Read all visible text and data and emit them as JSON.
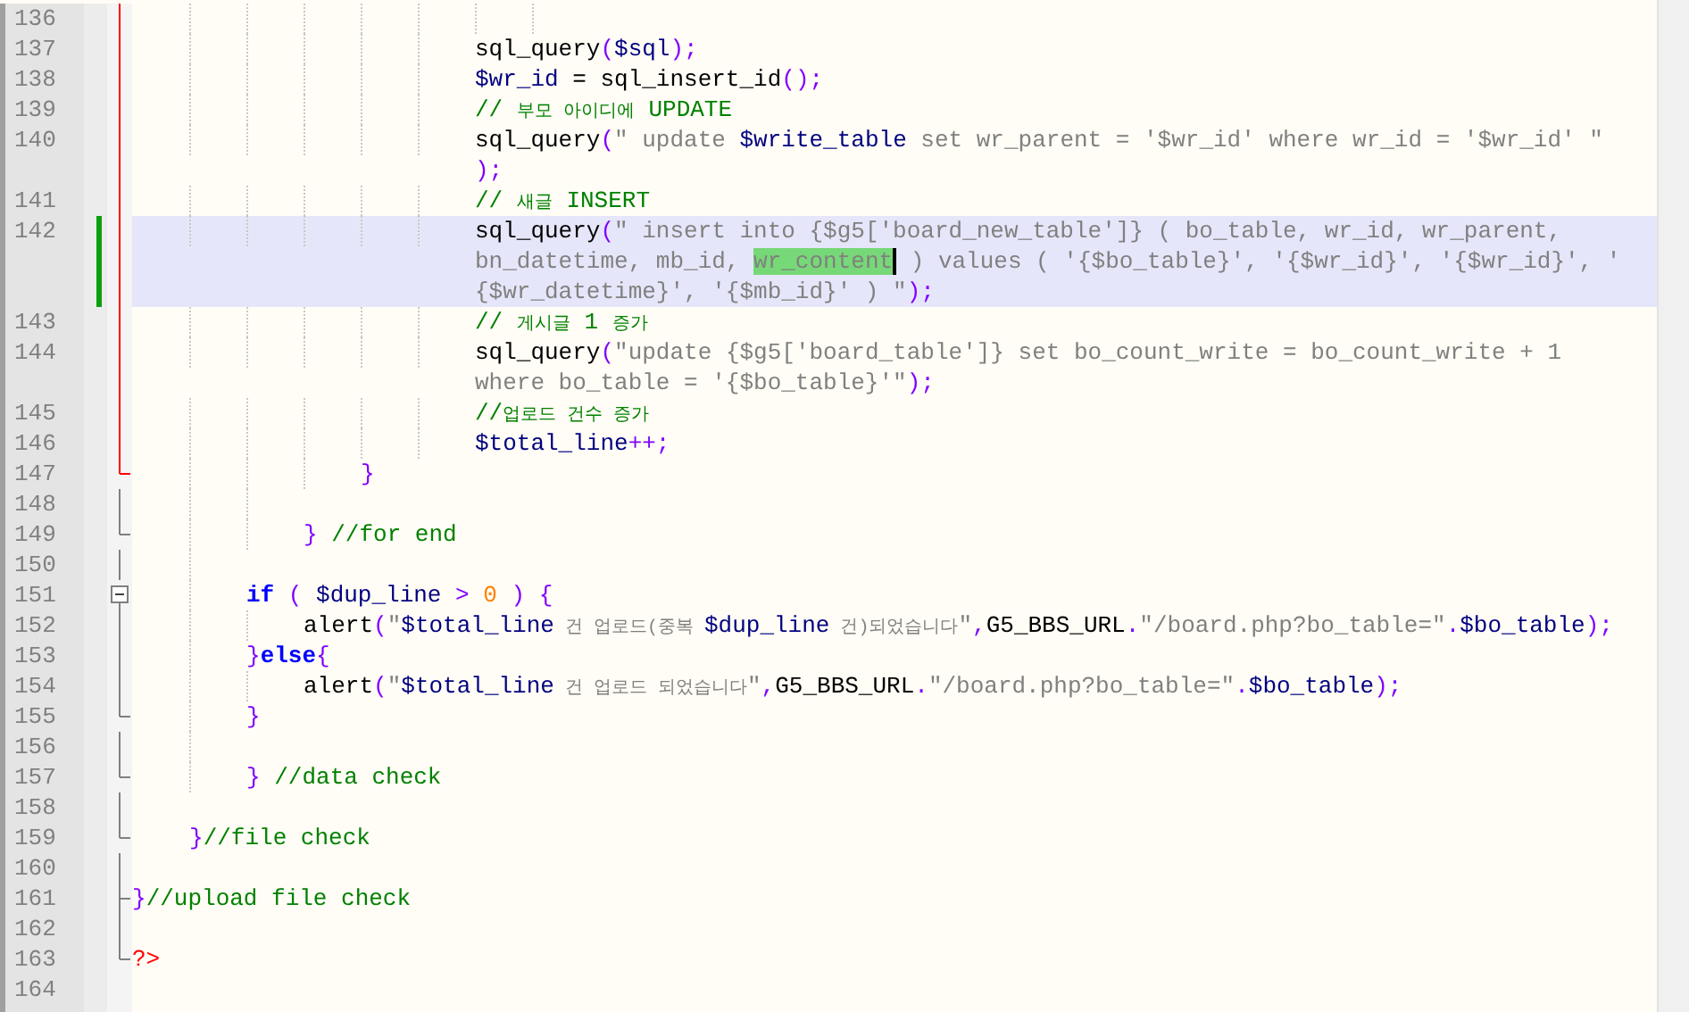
{
  "editor": {
    "lines": [
      {
        "children": [
          {
            "children": [
              {
                "children": [
                  {
                    "children": [
                      {
                        "children": [
                          {
                            "children": [
                              {
                                "children": [
                                  {
                                    "children": [
                                      {
                                        "number": "136",
                                        "kind": "redline",
                                        "changed": false,
                                        "current": false
                                      }
                                    ]
                                  }
                                ]
                              },
                              {
                                "number": "137",
                                "kind": "redline",
                                "changed": false,
                                "current": false,
                                "wraps": [
                                  {
                                    "tokens": [
                                      {
                                        "kind": "fn",
                                        "text": "sql_query"
                                      },
                                      {
                                        "kind": "punc",
                                        "text": "("
                                      },
                                      {
                                        "kind": "var",
                                        "text": "$sql"
                                      },
                                      {
                                        "kind": "punc",
                                        "text": ");"
                                      }
                                    ]
                                  }
                                ]
                              },
                              {
                                "number": "138",
                                "kind": "redline",
                                "changed": false,
                                "current": false,
                                "wraps": [
                                  {
                                    "tokens": [
                                      {
                                        "kind": "var",
                                        "text": "$wr_id"
                                      },
                                      {
                                        "kind": "fn",
                                        "text": " = sql_insert_id"
                                      },
                                      {
                                        "kind": "punc",
                                        "text": "();"
                                      }
                                    ]
                                  }
                                ]
                              },
                              {
                                "number": "139",
                                "kind": "redline",
                                "changed": false,
                                "current": false,
                                "wraps": [
                                  {
                                    "tokens": [
                                      {
                                        "kind": "cmt",
                                        "text": "// "
                                      },
                                      {
                                        "kind": "cmt_kr",
                                        "text": "부모 아이디에"
                                      },
                                      {
                                        "kind": "cmt",
                                        "text": " UPDATE"
                                      }
                                    ]
                                  }
                                ]
                              },
                              {
                                "number": "140",
                                "kind": "redline",
                                "changed": false,
                                "current": false,
                                "wraps": [
                                  {
                                    "tokens": [
                                      {
                                        "kind": "fn",
                                        "text": "sql_query"
                                      },
                                      {
                                        "kind": "punc",
                                        "text": "("
                                      },
                                      {
                                        "kind": "str",
                                        "text": "\" update "
                                      },
                                      {
                                        "kind": "var",
                                        "text": "$write_table"
                                      },
                                      {
                                        "kind": "str",
                                        "text": " set wr_parent = '$wr_id' where wr_id = '$wr_id' \""
                                      }
                                    ]
                                  },
                                  {
                                    "tokens": [
                                      {
                                        "kind": "punc",
                                        "text": ");"
                                      }
                                    ]
                                  }
                                ]
                              },
                              {
                                "number": "141",
                                "kind": "redline",
                                "changed": false,
                                "current": false,
                                "wraps": [
                                  {
                                    "tokens": [
                                      {
                                        "kind": "cmt",
                                        "text": "// "
                                      },
                                      {
                                        "kind": "cmt_kr",
                                        "text": "새글"
                                      },
                                      {
                                        "kind": "cmt",
                                        "text": " INSERT"
                                      }
                                    ]
                                  }
                                ]
                              },
                              {
                                "number": "142",
                                "kind": "redline",
                                "changed": true,
                                "current": true,
                                "wraps": [
                                  {
                                    "tokens": [
                                      {
                                        "kind": "fn",
                                        "text": "sql_query"
                                      },
                                      {
                                        "kind": "punc",
                                        "text": "("
                                      },
                                      {
                                        "kind": "str",
                                        "text": "\" insert into {$g5['board_new_table']} ( bo_table, wr_id, wr_parent,"
                                      }
                                    ]
                                  },
                                  {
                                    "tokens": [
                                      {
                                        "kind": "str",
                                        "text": "bn_datetime, mb_id, "
                                      },
                                      {
                                        "kind": "match",
                                        "text": "wr_content"
                                      },
                                      {
                                        "kind": "str",
                                        "text": " ) values ( '{$bo_table}', '{$wr_id}', '{$wr_id}', '"
                                      }
                                    ]
                                  },
                                  {
                                    "tokens": [
                                      {
                                        "kind": "str",
                                        "text": "{$wr_datetime}', '{$mb_id}' ) \""
                                      },
                                      {
                                        "kind": "punc",
                                        "text": ");"
                                      }
                                    ]
                                  }
                                ]
                              },
                              {
                                "number": "143",
                                "kind": "redline",
                                "changed": false,
                                "current": false,
                                "wraps": [
                                  {
                                    "tokens": [
                                      {
                                        "kind": "cmt",
                                        "text": "// "
                                      },
                                      {
                                        "kind": "cmt_kr",
                                        "text": "게시글"
                                      },
                                      {
                                        "kind": "cmt",
                                        "text": " 1 "
                                      },
                                      {
                                        "kind": "cmt_kr",
                                        "text": "증가"
                                      }
                                    ]
                                  }
                                ]
                              },
                              {
                                "number": "144",
                                "kind": "redline",
                                "changed": false,
                                "current": false,
                                "wraps": [
                                  {
                                    "tokens": [
                                      {
                                        "kind": "fn",
                                        "text": "sql_query"
                                      },
                                      {
                                        "kind": "punc",
                                        "text": "("
                                      },
                                      {
                                        "kind": "str",
                                        "text": "\"update {$g5['board_table']} set bo_count_write = bo_count_write + 1"
                                      }
                                    ]
                                  },
                                  {
                                    "tokens": [
                                      {
                                        "kind": "str",
                                        "text": "where bo_table = '{$bo_table}'\""
                                      },
                                      {
                                        "kind": "punc",
                                        "text": ");"
                                      }
                                    ]
                                  }
                                ]
                              },
                              {
                                "number": "145",
                                "kind": "redline",
                                "changed": false,
                                "current": false,
                                "wraps": [
                                  {
                                    "tokens": [
                                      {
                                        "kind": "cmt",
                                        "text": "//"
                                      },
                                      {
                                        "kind": "cmt_kr",
                                        "text": "업로드 건수 증가"
                                      }
                                    ]
                                  }
                                ]
                              },
                              {
                                "number": "146",
                                "kind": "redline",
                                "changed": false,
                                "current": false,
                                "wraps": [
                                  {
                                    "tokens": [
                                      {
                                        "kind": "var",
                                        "text": "$total_line"
                                      },
                                      {
                                        "kind": "punc",
                                        "text": "++;"
                                      }
                                    ]
                                  }
                                ]
                              }
                            ]
                          }
                        ]
                      },
                      {
                        "number": "147",
                        "kind": "redend",
                        "changed": false,
                        "current": false,
                        "wraps": [
                          {
                            "tokens": [
                              {
                                "kind": "punc",
                                "text": "}"
                              }
                            ]
                          }
                        ]
                      }
                    ]
                  },
                  {
                    "number": "148",
                    "kind": "line",
                    "changed": false,
                    "current": false
                  },
                  {
                    "number": "149",
                    "kind": "end",
                    "changed": false,
                    "current": false,
                    "wraps": [
                      {
                        "tokens": [
                          {
                            "kind": "punc",
                            "text": "}"
                          },
                          {
                            "kind": "cmt",
                            "text": " //for end"
                          }
                        ]
                      }
                    ]
                  }
                ]
              },
              {
                "number": "150",
                "kind": "line",
                "changed": false,
                "current": false
              },
              {
                "number": "151",
                "kind": "box",
                "changed": false,
                "current": false,
                "wraps": [
                  {
                    "tokens": [
                      {
                        "kind": "kw",
                        "text": "if"
                      },
                      {
                        "kind": "punc",
                        "text": " ( "
                      },
                      {
                        "kind": "var",
                        "text": "$dup_line"
                      },
                      {
                        "kind": "punc",
                        "text": " > "
                      },
                      {
                        "kind": "num",
                        "text": "0"
                      },
                      {
                        "kind": "punc",
                        "text": " ) {"
                      }
                    ]
                  }
                ]
              },
              {
                "children": [
                  {
                    "number": "152",
                    "kind": "line",
                    "changed": false,
                    "current": false,
                    "wraps": [
                      {
                        "tokens": [
                          {
                            "kind": "fn",
                            "text": "alert"
                          },
                          {
                            "kind": "punc",
                            "text": "("
                          },
                          {
                            "kind": "str",
                            "text": "\""
                          },
                          {
                            "kind": "var",
                            "text": "$total_line"
                          },
                          {
                            "kind": "str_kr",
                            "text": " 건 업로드(중복 "
                          },
                          {
                            "kind": "var",
                            "text": "$dup_line"
                          },
                          {
                            "kind": "str_kr",
                            "text": " 건)되었습니다"
                          },
                          {
                            "kind": "str",
                            "text": "\""
                          },
                          {
                            "kind": "punc",
                            "text": ","
                          },
                          {
                            "kind": "fn",
                            "text": "G5_BBS_URL"
                          },
                          {
                            "kind": "punc",
                            "text": "."
                          },
                          {
                            "kind": "str",
                            "text": "\"/board.php?bo_table=\""
                          },
                          {
                            "kind": "punc",
                            "text": "."
                          },
                          {
                            "kind": "var",
                            "text": "$bo_table"
                          },
                          {
                            "kind": "punc",
                            "text": ");"
                          }
                        ]
                      }
                    ]
                  }
                ]
              },
              {
                "number": "153",
                "kind": "line",
                "changed": false,
                "current": false,
                "wraps": [
                  {
                    "tokens": [
                      {
                        "kind": "punc",
                        "text": "}"
                      },
                      {
                        "kind": "kw",
                        "text": "else"
                      },
                      {
                        "kind": "punc",
                        "text": "{"
                      }
                    ]
                  }
                ]
              },
              {
                "children": [
                  {
                    "number": "154",
                    "kind": "line",
                    "changed": false,
                    "current": false,
                    "wraps": [
                      {
                        "tokens": [
                          {
                            "kind": "fn",
                            "text": "alert"
                          },
                          {
                            "kind": "punc",
                            "text": "("
                          },
                          {
                            "kind": "str",
                            "text": "\""
                          },
                          {
                            "kind": "var",
                            "text": "$total_line"
                          },
                          {
                            "kind": "str_kr",
                            "text": " 건 업로드 되었습니다"
                          },
                          {
                            "kind": "str",
                            "text": "\""
                          },
                          {
                            "kind": "punc",
                            "text": ","
                          },
                          {
                            "kind": "fn",
                            "text": "G5_BBS_URL"
                          },
                          {
                            "kind": "punc",
                            "text": "."
                          },
                          {
                            "kind": "str",
                            "text": "\"/board.php?bo_table=\""
                          },
                          {
                            "kind": "punc",
                            "text": "."
                          },
                          {
                            "kind": "var",
                            "text": "$bo_table"
                          },
                          {
                            "kind": "punc",
                            "text": ");"
                          }
                        ]
                      }
                    ]
                  }
                ]
              },
              {
                "number": "155",
                "kind": "end",
                "changed": false,
                "current": false,
                "wraps": [
                  {
                    "tokens": [
                      {
                        "kind": "punc",
                        "text": "}"
                      }
                    ]
                  }
                ]
              },
              {
                "number": "156",
                "kind": "line",
                "changed": false,
                "current": false
              },
              {
                "number": "157",
                "kind": "end",
                "changed": false,
                "current": false,
                "wraps": [
                  {
                    "tokens": [
                      {
                        "kind": "punc",
                        "text": "}"
                      },
                      {
                        "kind": "cmt",
                        "text": " //data check"
                      }
                    ]
                  }
                ]
              }
            ]
          }
        ]
      },
      {
        "number": "158",
        "kind": "line",
        "changed": false,
        "current": false
      },
      {
        "children": [
          {
            "number": "159",
            "kind": "end",
            "changed": false,
            "current": false,
            "wraps": [
              {
                "tokens": [
                  {
                    "kind": "punc",
                    "text": "}"
                  },
                  {
                    "kind": "cmt",
                    "text": "//file check"
                  }
                ]
              }
            ]
          }
        ]
      },
      {
        "number": "160",
        "kind": "line",
        "changed": false,
        "current": false
      },
      {
        "number": "161",
        "kind": "mid",
        "changed": false,
        "current": false,
        "wraps": [
          {
            "tokens": [
              {
                "kind": "punc",
                "text": "}"
              },
              {
                "kind": "cmt",
                "text": "//upload file check"
              }
            ]
          }
        ]
      },
      {
        "number": "162",
        "kind": "line",
        "changed": false,
        "current": false
      },
      {
        "number": "163",
        "kind": "last",
        "changed": false,
        "current": false,
        "wraps": [
          {
            "tokens": [
              {
                "kind": "tag",
                "text": "?>"
              }
            ]
          }
        ]
      },
      {
        "number": "164",
        "kind": "plain",
        "changed": false,
        "current": false
      }
    ]
  }
}
